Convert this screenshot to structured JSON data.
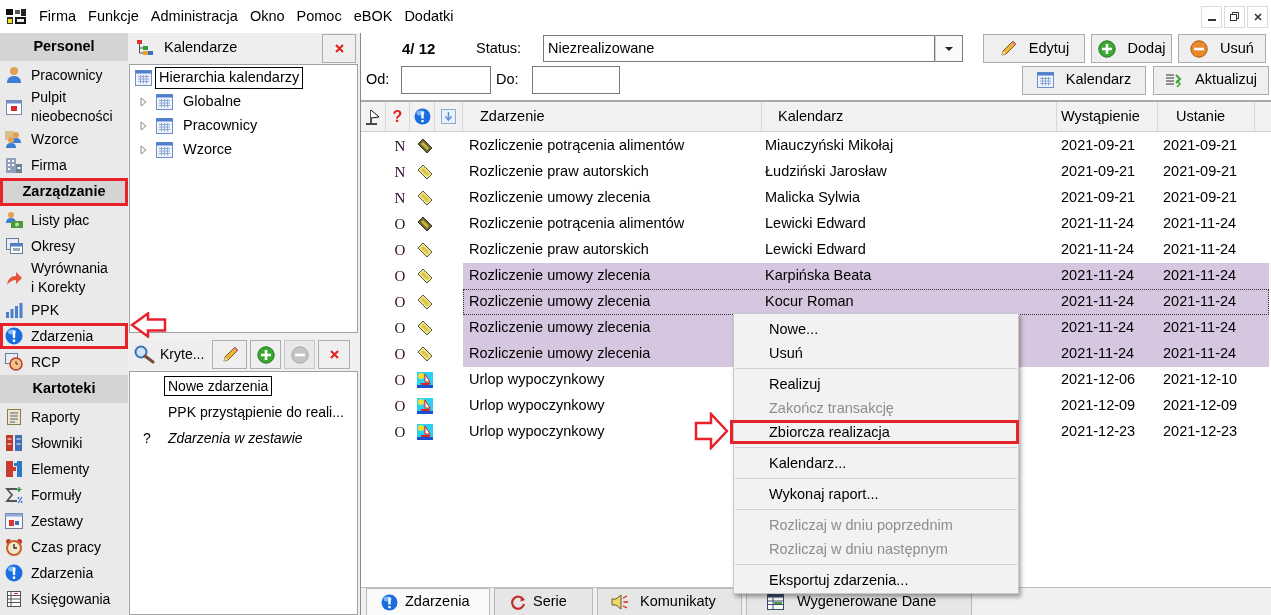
{
  "menu_bar": {
    "items": [
      "Firma",
      "Funkcje",
      "Administracja",
      "Okno",
      "Pomoc",
      "eBOK",
      "Dodatki"
    ]
  },
  "sidebar": {
    "sections": [
      {
        "title": "Personel",
        "highlighted": false,
        "items": [
          {
            "label": "Pracownicy",
            "highlighted": false
          },
          {
            "label": "Pulpit nieobecności",
            "highlighted": false
          },
          {
            "label": "Wzorce",
            "highlighted": false
          },
          {
            "label": "Firma",
            "highlighted": false
          }
        ]
      },
      {
        "title": "Zarządzanie",
        "highlighted": true,
        "items": [
          {
            "label": "Listy płac",
            "highlighted": false
          },
          {
            "label": "Okresy",
            "highlighted": false
          },
          {
            "label": "Wyrównania i Korekty",
            "highlighted": false
          },
          {
            "label": "PPK",
            "highlighted": false
          },
          {
            "label": "Zdarzenia",
            "highlighted": true
          },
          {
            "label": "RCP",
            "highlighted": false
          }
        ]
      },
      {
        "title": "Kartoteki",
        "highlighted": false,
        "items": [
          {
            "label": "Raporty",
            "highlighted": false
          },
          {
            "label": "Słowniki",
            "highlighted": false
          },
          {
            "label": "Elementy",
            "highlighted": false
          },
          {
            "label": "Formuły",
            "highlighted": false
          },
          {
            "label": "Zestawy",
            "highlighted": false
          },
          {
            "label": "Czas pracy",
            "highlighted": false
          },
          {
            "label": "Zdarzenia",
            "highlighted": false
          },
          {
            "label": "Księgowania",
            "highlighted": false
          }
        ]
      }
    ]
  },
  "calendars_panel": {
    "title": "Kalendarze",
    "tree": [
      {
        "label": "Hierarchia kalendarzy",
        "focused": true,
        "children": [
          {
            "label": "Globalne",
            "focused": false,
            "expanded": false
          },
          {
            "label": "Pracownicy",
            "focused": false,
            "expanded": false
          },
          {
            "label": "Wzorce",
            "focused": false,
            "expanded": false
          }
        ]
      }
    ]
  },
  "criteria_panel": {
    "button": "Kryte...",
    "tools": [
      {
        "kind": "edit",
        "disabled": false
      },
      {
        "kind": "add",
        "disabled": false
      },
      {
        "kind": "remove",
        "disabled": true
      },
      {
        "kind": "close",
        "disabled": false
      }
    ],
    "items": [
      {
        "kind": "criterion",
        "label": "Nowe zdarzenia",
        "focused": true
      },
      {
        "kind": "criterion",
        "label": "PPK przystąpienie do reali...",
        "focused": false
      },
      {
        "kind": "set",
        "marker": "?",
        "label": "Zdarzenia w zestawie",
        "focused": false
      }
    ]
  },
  "toolbar": {
    "counter": "4/ 12",
    "status_label": "Status:",
    "status_value": "Niezrealizowane",
    "buttons": [
      {
        "kind": "edit",
        "label": "Edytuj"
      },
      {
        "kind": "add",
        "label": "Dodaj"
      },
      {
        "kind": "remove",
        "label": "Usuń"
      }
    ],
    "from_label": "Od:",
    "to_label": "Do:",
    "buttons_2": [
      {
        "kind": "calendar",
        "label": "Kalendarz"
      },
      {
        "kind": "refresh",
        "label": "Aktualizuj"
      }
    ]
  },
  "table": {
    "marker_header": "?",
    "columns": [
      "Zdarzenie",
      "Kalendarz",
      "Wystąpienie",
      "Ustanie"
    ],
    "rows": [
      {
        "status": "N",
        "kind": "deduction",
        "event": "Rozliczenie potrącenia alimentów",
        "calendar": "Miauczyński Mikołaj",
        "occurs": "2021-09-21",
        "ends": "2021-09-21",
        "selected": false,
        "focused": false
      },
      {
        "status": "N",
        "kind": "payment",
        "event": "Rozliczenie praw autorskich",
        "calendar": "Łudziński Jarosław",
        "occurs": "2021-09-21",
        "ends": "2021-09-21",
        "selected": false,
        "focused": false
      },
      {
        "status": "N",
        "kind": "payment",
        "event": "Rozliczenie umowy zlecenia",
        "calendar": "Malicka Sylwia",
        "occurs": "2021-09-21",
        "ends": "2021-09-21",
        "selected": false,
        "focused": false
      },
      {
        "status": "O",
        "kind": "deduction",
        "event": "Rozliczenie potrącenia alimentów",
        "calendar": "Lewicki Edward",
        "occurs": "2021-11-24",
        "ends": "2021-11-24",
        "selected": false,
        "focused": false
      },
      {
        "status": "O",
        "kind": "payment",
        "event": "Rozliczenie praw autorskich",
        "calendar": "Lewicki Edward",
        "occurs": "2021-11-24",
        "ends": "2021-11-24",
        "selected": false,
        "focused": false
      },
      {
        "status": "O",
        "kind": "payment",
        "event": "Rozliczenie umowy zlecenia",
        "calendar": "Karpińska Beata",
        "occurs": "2021-11-24",
        "ends": "2021-11-24",
        "selected": true,
        "focused": false
      },
      {
        "status": "O",
        "kind": "payment",
        "event": "Rozliczenie umowy zlecenia",
        "calendar": "Kocur Roman",
        "occurs": "2021-11-24",
        "ends": "2021-11-24",
        "selected": true,
        "focused": true
      },
      {
        "status": "O",
        "kind": "payment",
        "event": "Rozliczenie umowy zlecenia",
        "occurs": "2021-11-24",
        "ends": "2021-11-24",
        "selected": true,
        "focused": false
      },
      {
        "status": "O",
        "kind": "payment",
        "event": "Rozliczenie umowy zlecenia",
        "occurs": "2021-11-24",
        "ends": "2021-11-24",
        "selected": true,
        "focused": false
      },
      {
        "status": "O",
        "kind": "leave",
        "event": "Urlop wypoczynkowy",
        "occurs": "2021-12-06",
        "ends": "2021-12-10",
        "selected": false,
        "focused": false
      },
      {
        "status": "O",
        "kind": "leave",
        "event": "Urlop wypoczynkowy",
        "occurs": "2021-12-09",
        "ends": "2021-12-09",
        "selected": false,
        "focused": false
      },
      {
        "status": "O",
        "kind": "leave",
        "event": "Urlop wypoczynkowy",
        "occurs": "2021-12-23",
        "ends": "2021-12-23",
        "selected": false,
        "focused": false
      }
    ]
  },
  "context_menu": {
    "items": [
      {
        "kind": "item",
        "label": "Nowe...",
        "disabled": false,
        "highlighted": false
      },
      {
        "kind": "item",
        "label": "Usuń",
        "disabled": false,
        "highlighted": false
      },
      {
        "kind": "separator"
      },
      {
        "kind": "item",
        "label": "Realizuj",
        "disabled": false,
        "highlighted": false
      },
      {
        "kind": "item",
        "label": "Zakończ transakcję",
        "disabled": true,
        "highlighted": false
      },
      {
        "kind": "item",
        "label": "Zbiorcza realizacja",
        "disabled": false,
        "highlighted": true
      },
      {
        "kind": "separator"
      },
      {
        "kind": "item",
        "label": "Kalendarz...",
        "disabled": false,
        "highlighted": false
      },
      {
        "kind": "separator"
      },
      {
        "kind": "item",
        "label": "Wykonaj raport...",
        "disabled": false,
        "highlighted": false
      },
      {
        "kind": "separator"
      },
      {
        "kind": "item",
        "label": "Rozliczaj w dniu poprzednim",
        "disabled": true,
        "highlighted": false
      },
      {
        "kind": "item",
        "label": "Rozliczaj w dniu następnym",
        "disabled": true,
        "highlighted": false
      },
      {
        "kind": "separator"
      },
      {
        "kind": "item",
        "label": "Eksportuj zdarzenia...",
        "disabled": false,
        "highlighted": false
      }
    ]
  },
  "bottom_tabs": [
    {
      "label": "Zdarzenia",
      "selected": true
    },
    {
      "label": "Serie",
      "selected": false
    },
    {
      "label": "Komunikaty",
      "selected": false
    },
    {
      "label": "Wygenerowane Dane",
      "selected": false
    }
  ]
}
